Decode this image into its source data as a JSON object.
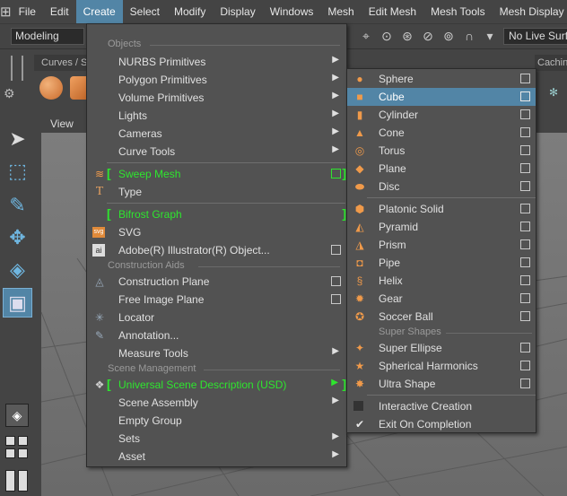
{
  "menubar": {
    "items": [
      "File",
      "Edit",
      "Create",
      "Select",
      "Modify",
      "Display",
      "Windows",
      "Mesh",
      "Edit Mesh",
      "Mesh Tools",
      "Mesh Display"
    ],
    "active": "Create"
  },
  "statusline": {
    "workspace": "Modeling",
    "live_surface": "No Live Surfa"
  },
  "shelf": {
    "tab_curves": "Curves / S",
    "tab_caching": "Cachin"
  },
  "viewport": {
    "view_label": "View"
  },
  "create_menu": {
    "sections": {
      "objects": "Objects",
      "construction_aids": "Construction Aids",
      "scene_management": "Scene Management"
    },
    "items": {
      "nurbs": "NURBS Primitives",
      "polygon": "Polygon Primitives",
      "volume": "Volume Primitives",
      "lights": "Lights",
      "cameras": "Cameras",
      "curve_tools": "Curve Tools",
      "sweep_mesh": "Sweep Mesh",
      "type": "Type",
      "bifrost": "Bifrost Graph",
      "svg": "SVG",
      "illustrator": "Adobe(R) Illustrator(R) Object...",
      "construction_plane": "Construction Plane",
      "free_image_plane": "Free Image Plane",
      "locator": "Locator",
      "annotation": "Annotation...",
      "measure_tools": "Measure Tools",
      "usd": "Universal Scene Description (USD)",
      "scene_assembly": "Scene Assembly",
      "empty_group": "Empty Group",
      "sets": "Sets",
      "asset": "Asset"
    }
  },
  "poly_menu": {
    "super_shapes_label": "Super Shapes",
    "items": {
      "sphere": "Sphere",
      "cube": "Cube",
      "cylinder": "Cylinder",
      "cone": "Cone",
      "torus": "Torus",
      "plane": "Plane",
      "disc": "Disc",
      "platonic": "Platonic Solid",
      "pyramid": "Pyramid",
      "prism": "Prism",
      "pipe": "Pipe",
      "helix": "Helix",
      "gear": "Gear",
      "soccer": "Soccer Ball",
      "super_ellipse": "Super Ellipse",
      "spherical_harmonics": "Spherical Harmonics",
      "ultra_shape": "Ultra Shape",
      "interactive": "Interactive Creation",
      "exit_on_completion": "Exit On Completion"
    },
    "highlighted": "Cube",
    "exit_on_completion_checked": true
  },
  "colors": {
    "highlight": "#5285a6",
    "menu_bg": "#525252",
    "green_text": "#2ee62e",
    "icon_orange": "#f09a4a"
  }
}
